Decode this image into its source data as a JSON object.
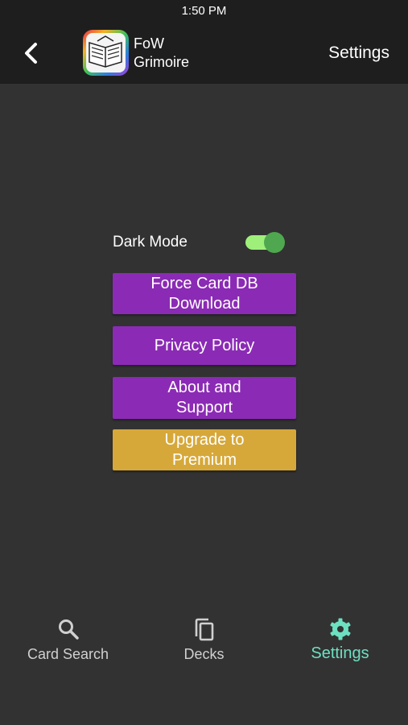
{
  "status_bar": {
    "time": "1:50 PM"
  },
  "header": {
    "app_name_line1": "FoW",
    "app_name_line2": "Grimoire",
    "title": "Settings",
    "back_icon": "chevron-left-icon",
    "logo_icon": "open-book-logo"
  },
  "settings": {
    "dark_mode_label": "Dark Mode",
    "dark_mode_on": true,
    "buttons": [
      {
        "line1": "Force Card DB",
        "line2": "Download",
        "color": "#8b2bb5"
      },
      {
        "line1": "Privacy Policy",
        "line2": "",
        "color": "#8b2bb5"
      },
      {
        "line1": "About and",
        "line2": "Support",
        "color": "#8b2bb5"
      },
      {
        "line1": "Upgrade to",
        "line2": "Premium",
        "color": "#d6a83a"
      }
    ]
  },
  "tabs": [
    {
      "label": "Card Search",
      "icon": "search-icon",
      "active": false
    },
    {
      "label": "Decks",
      "icon": "copy-icon",
      "active": false
    },
    {
      "label": "Settings",
      "icon": "gear-icon",
      "active": true
    }
  ],
  "colors": {
    "background": "#323232",
    "header_bg": "#1e1e1e",
    "accent_active_tab": "#6ee0c2",
    "toggle_track": "#9ef07a",
    "toggle_knob": "#4fa84f"
  }
}
